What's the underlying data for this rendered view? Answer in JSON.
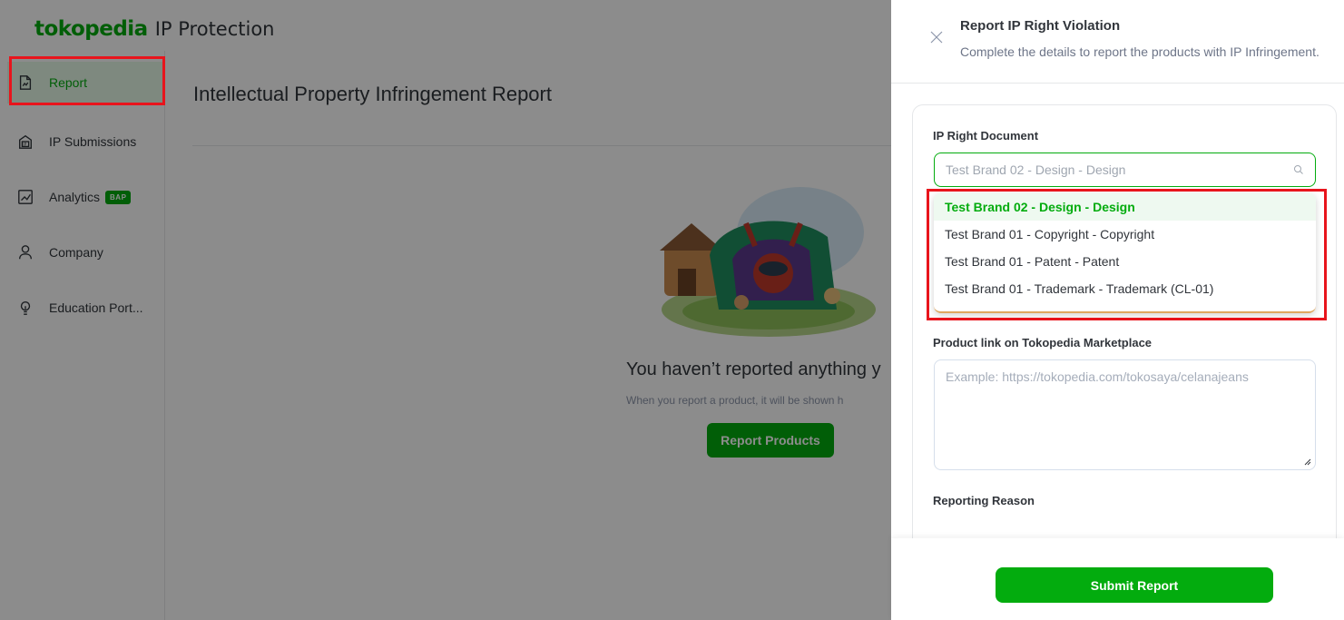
{
  "brand": {
    "logo_text": "tokopedia",
    "product_name": "IP Protection"
  },
  "sidebar": {
    "items": [
      {
        "label": "Report",
        "icon": "report-icon",
        "active": true
      },
      {
        "label": "IP Submissions",
        "icon": "ip-submissions-icon",
        "active": false
      },
      {
        "label": "Analytics",
        "icon": "analytics-icon",
        "active": false,
        "badge": "BAP"
      },
      {
        "label": "Company",
        "icon": "user-icon",
        "active": false
      },
      {
        "label": "Education Port...",
        "icon": "lightbulb-icon",
        "active": false
      }
    ]
  },
  "main": {
    "page_title": "Intellectual Property Infringement Report",
    "empty_title": "You haven’t reported anything y",
    "empty_subtitle": "When you report a product, it will be shown h",
    "report_products_label": "Report Products"
  },
  "drawer": {
    "title": "Report IP Right Violation",
    "subtitle": "Complete the details to report the products with IP Infringement.",
    "ip_document": {
      "label": "IP Right Document",
      "value": "Test Brand 02 - Design - Design",
      "options": [
        {
          "label": "Test Brand 02 - Design - Design",
          "selected": true
        },
        {
          "label": "Test Brand 01 - Copyright - Copyright",
          "selected": false
        },
        {
          "label": "Test Brand 01 - Patent - Patent",
          "selected": false
        },
        {
          "label": "Test Brand 01 - Trademark - Trademark (CL-01)",
          "selected": false
        }
      ]
    },
    "product_link": {
      "label": "Product link on Tokopedia Marketplace",
      "placeholder": "Example: https://tokopedia.com/tokosaya/celanajeans"
    },
    "reporting_reason": {
      "label": "Reporting Reason"
    },
    "submit_label": "Submit Report"
  },
  "colors": {
    "brand_green": "#03ac0e",
    "annotation_red": "#e8141c",
    "overlay": "rgba(0,0,0,0.45)"
  }
}
